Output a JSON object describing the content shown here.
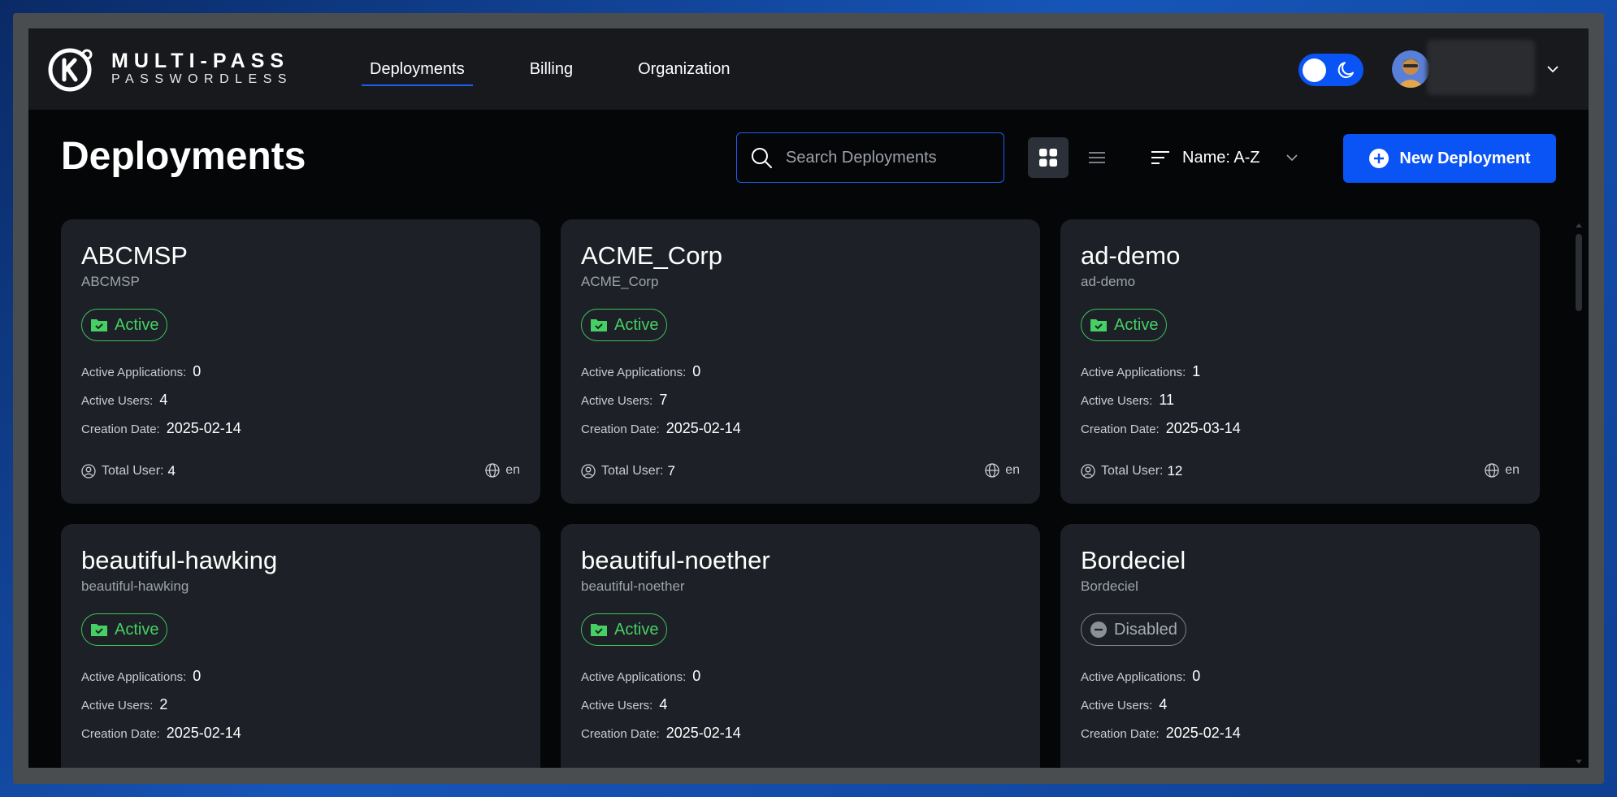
{
  "brand": {
    "title": "MULTI-PASS",
    "subtitle": "PASSWORDLESS",
    "mark": "K"
  },
  "nav": [
    {
      "label": "Deployments",
      "active": true
    },
    {
      "label": "Billing",
      "active": false
    },
    {
      "label": "Organization",
      "active": false
    }
  ],
  "page": {
    "title": "Deployments"
  },
  "search": {
    "placeholder": "Search Deployments"
  },
  "sort": {
    "label": "Name: A-Z"
  },
  "new_button": {
    "label": "New Deployment"
  },
  "labels": {
    "active_applications": "Active Applications:",
    "active_users": "Active Users:",
    "creation_date": "Creation Date:",
    "total_user": "Total User:"
  },
  "cards": [
    {
      "name": "ABCMSP",
      "sub": "ABCMSP",
      "status": "Active",
      "apps": "0",
      "users": "4",
      "date": "2025-02-14",
      "total": "4",
      "lang": "en"
    },
    {
      "name": "ACME_Corp",
      "sub": "ACME_Corp",
      "status": "Active",
      "apps": "0",
      "users": "7",
      "date": "2025-02-14",
      "total": "7",
      "lang": "en"
    },
    {
      "name": "ad-demo",
      "sub": "ad-demo",
      "status": "Active",
      "apps": "1",
      "users": "11",
      "date": "2025-03-14",
      "total": "12",
      "lang": "en"
    },
    {
      "name": "beautiful-hawking",
      "sub": "beautiful-hawking",
      "status": "Active",
      "apps": "0",
      "users": "2",
      "date": "2025-02-14"
    },
    {
      "name": "beautiful-noether",
      "sub": "beautiful-noether",
      "status": "Active",
      "apps": "0",
      "users": "4",
      "date": "2025-02-14"
    },
    {
      "name": "Bordeciel",
      "sub": "Bordeciel",
      "status": "Disabled",
      "apps": "0",
      "users": "4",
      "date": "2025-02-14"
    }
  ],
  "colors": {
    "accent": "#0a53f5",
    "active_green": "#46d064",
    "disabled_gray": "#a7acb4",
    "card_bg": "#1d2026"
  }
}
